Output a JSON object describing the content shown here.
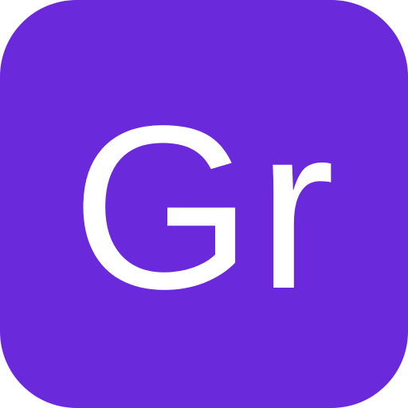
{
  "icon": {
    "monogram": "Gr",
    "background_color": "#6A29DB",
    "text_color": "#FFFFFF"
  }
}
